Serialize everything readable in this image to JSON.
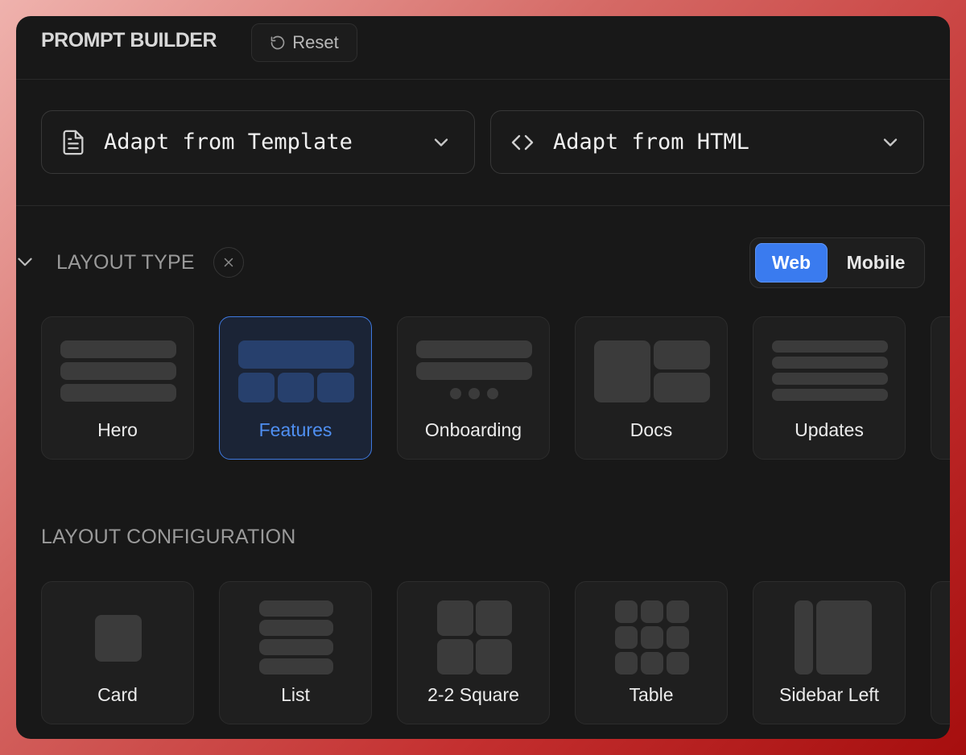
{
  "header": {
    "title": "PROMPT BUILDER",
    "reset_label": "Reset"
  },
  "adapt": {
    "template_label": "Adapt from Template",
    "html_label": "Adapt from HTML"
  },
  "layout_type": {
    "title": "LAYOUT TYPE",
    "platform": {
      "options": [
        "Web",
        "Mobile"
      ],
      "selected": "Web"
    },
    "options": [
      {
        "label": "Hero",
        "selected": false
      },
      {
        "label": "Features",
        "selected": true
      },
      {
        "label": "Onboarding",
        "selected": false
      },
      {
        "label": "Docs",
        "selected": false
      },
      {
        "label": "Updates",
        "selected": false
      }
    ]
  },
  "layout_configuration": {
    "title": "LAYOUT CONFIGURATION",
    "options": [
      {
        "label": "Card"
      },
      {
        "label": "List"
      },
      {
        "label": "2-2 Square"
      },
      {
        "label": "Table"
      },
      {
        "label": "Sidebar Left"
      }
    ]
  },
  "colors": {
    "accent": "#3a7bef",
    "panel_bg": "#181818",
    "card_bg": "#1f1f1f",
    "selected_bg": "#1b2436",
    "selected_text": "#4f8ff2"
  },
  "icons": {
    "reset": "rotate-ccw-icon",
    "template": "file-text-icon",
    "html": "code-icon",
    "dropdown": "chevron-down-icon",
    "clear": "close-icon"
  }
}
